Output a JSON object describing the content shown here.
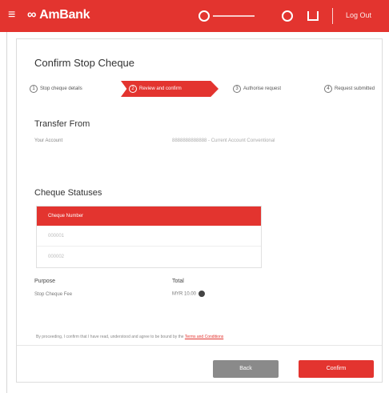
{
  "topbar": {
    "menu_glyph": "≡",
    "brand_mark": "∞",
    "brand": "AmBank",
    "logout": "Log Out",
    "icons": [
      "menu-icon",
      "clock-icon",
      "help-icon",
      "inbox-icon"
    ],
    "colors": {
      "brand_red": "#e3342f"
    }
  },
  "page": {
    "title": "Confirm Stop Cheque"
  },
  "steps": [
    {
      "num": "1",
      "label": "Stop cheque details"
    },
    {
      "num": "2",
      "label": "Review and confirm"
    },
    {
      "num": "3",
      "label": "Authorise request"
    },
    {
      "num": "4",
      "label": "Request submitted"
    }
  ],
  "transfer_from": {
    "heading": "Transfer From",
    "account_label": "Your Account",
    "account_value": "8888888888888 - Current Account Conventional"
  },
  "cheque_statuses": {
    "heading": "Cheque Statuses",
    "column_header": "Cheque Number",
    "rows": [
      "000001",
      "000002"
    ]
  },
  "fees": {
    "purpose_header": "Purpose",
    "fee_header": "Total",
    "item_label": "Stop Cheque Fee",
    "item_value": "MYR 10.00"
  },
  "terms": {
    "text": "By proceeding, I confirm that I have read, understood and agree to be bound by the ",
    "link": "Terms and Conditions"
  },
  "actions": {
    "back": "Back",
    "confirm": "Confirm"
  }
}
